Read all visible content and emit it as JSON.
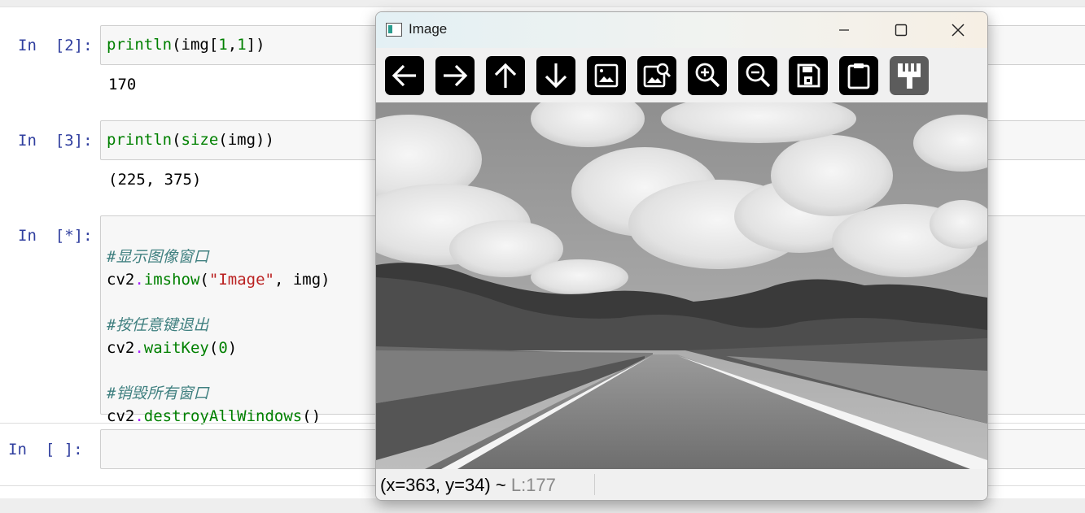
{
  "cells": [
    {
      "prompt": "In  [2]:",
      "code_fn": "println",
      "code_rest": "(img[",
      "code_n1": "1",
      "code_comma": ",",
      "code_n2": "1",
      "code_end": "])",
      "output": "170"
    },
    {
      "prompt": "In  [3]:",
      "code_fn": "println",
      "code_paren": "(",
      "code_fn2": "size",
      "code_rest": "(img))",
      "output": "(225, 375)"
    },
    {
      "prompt": "In  [*]:",
      "lines": {
        "c1": "#显示图像窗口",
        "l2_obj": "cv2",
        "l2_dot": ".",
        "l2_fn": "imshow",
        "l2_open": "(",
        "l2_str": "\"Image\"",
        "l2_rest": ", img)",
        "c2": "#按任意键退出",
        "l4_obj": "cv2",
        "l4_dot": ".",
        "l4_fn": "waitKey",
        "l4_open": "(",
        "l4_num": "0",
        "l4_close": ")",
        "c3": "#销毁所有窗口",
        "l6_obj": "cv2",
        "l6_dot": ".",
        "l6_fn": "destroyAllWindows",
        "l6_rest": "()"
      }
    },
    {
      "prompt": "In  [ ]:"
    }
  ],
  "window": {
    "title": "Image",
    "toolbar": [
      "arrow-left",
      "arrow-right",
      "arrow-up",
      "arrow-down",
      "image",
      "image-search",
      "zoom-in",
      "zoom-out",
      "save",
      "clipboard",
      "paint-brush"
    ],
    "status_coords": "(x=363, y=34) ~ ",
    "status_value": "L:177"
  },
  "colors": {
    "prompt": "#303f9f",
    "builtin": "#008000",
    "string": "#ba2121",
    "comment": "#408080",
    "operator": "#aa22ff"
  }
}
